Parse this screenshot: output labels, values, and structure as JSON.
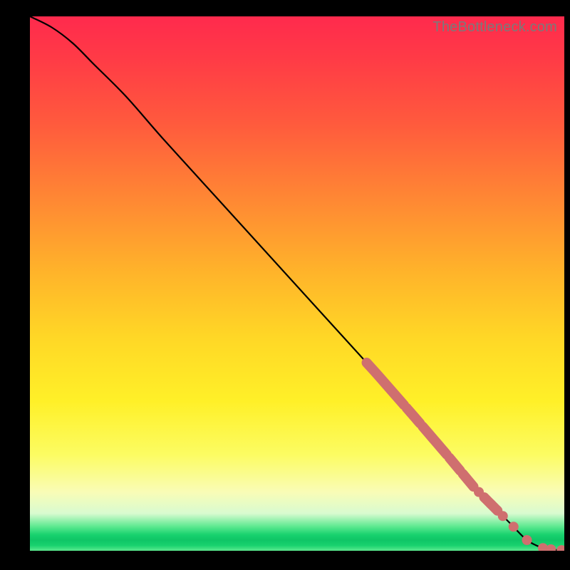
{
  "watermark": "TheBottleneck.com",
  "chart_data": {
    "type": "line",
    "title": "",
    "xlabel": "",
    "ylabel": "",
    "xlim": [
      0,
      100
    ],
    "ylim": [
      0,
      100
    ],
    "grid": false,
    "legend": false,
    "series": [
      {
        "name": "curve",
        "x": [
          0,
          4,
          8,
          12,
          18,
          25,
          35,
          45,
          55,
          65,
          72,
          78,
          83,
          87,
          90,
          93,
          96,
          98,
          100
        ],
        "y": [
          100,
          98,
          95,
          91,
          85,
          77,
          66,
          55,
          44,
          33,
          25,
          18,
          12,
          8,
          5,
          2,
          0.5,
          0.2,
          0.1
        ]
      }
    ],
    "highlight_segments_x": [
      [
        63,
        70
      ],
      [
        70.5,
        73
      ],
      [
        73.5,
        78
      ],
      [
        78.5,
        80.5
      ],
      [
        81,
        83
      ],
      [
        85,
        87.5
      ]
    ],
    "tail_dots_x": [
      84,
      88.5,
      90.5,
      93,
      96,
      97.5,
      99.5
    ],
    "colors": {
      "curve": "#000000",
      "marker": "#cf6f6f",
      "gradient_top": "#ff2a4d",
      "gradient_bottom": "#18d26e"
    }
  }
}
